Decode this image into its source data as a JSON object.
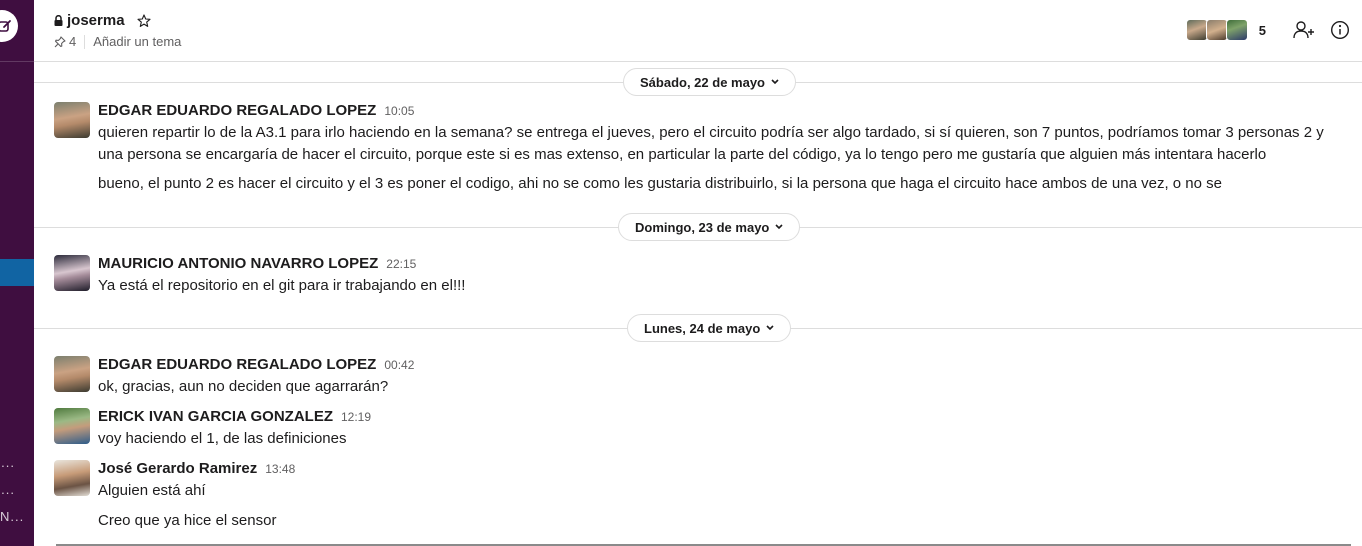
{
  "sidebar": {
    "truncated_items": [
      "...",
      "...",
      "N..."
    ],
    "compose_icon": "compose-icon"
  },
  "header": {
    "channel_name": "joserma",
    "pin_count": "4",
    "topic_placeholder": "Añadir un tema",
    "member_count": "5",
    "icons": [
      "lock-icon",
      "star-icon",
      "pin-icon",
      "add-member-icon",
      "info-icon"
    ]
  },
  "date_dividers": [
    {
      "label": "Sábado, 22 de mayo"
    },
    {
      "label": "Domingo, 23 de mayo"
    },
    {
      "label": "Lunes, 24 de mayo"
    }
  ],
  "messages": [
    {
      "sender": "EDGAR EDUARDO REGALADO LOPEZ",
      "time": "10:05",
      "lines": [
        "quieren repartir lo de la A3.1 para irlo haciendo en la semana? se entrega el jueves, pero el circuito podría ser algo tardado, si sí quieren, son 7 puntos, podríamos tomar 3 personas 2 y una persona se encargaría de hacer el circuito, porque este si es mas extenso, en particular la parte del código, ya lo tengo pero me gustaría que alguien más intentara hacerlo",
        "bueno, el punto 2 es hacer el circuito y el 3 es poner el codigo, ahi no se como les gustaria distribuirlo, si la persona que haga el circuito hace ambos de una vez, o no se"
      ]
    },
    {
      "sender": "MAURICIO ANTONIO NAVARRO LOPEZ",
      "time": "22:15",
      "lines": [
        "Ya está el repositorio en el git para ir trabajando en el!!!"
      ]
    },
    {
      "sender": "EDGAR EDUARDO REGALADO LOPEZ",
      "time": "00:42",
      "lines": [
        "ok, gracias, aun no deciden que agarrarán?"
      ]
    },
    {
      "sender": "ERICK IVAN GARCIA GONZALEZ",
      "time": "12:19",
      "lines": [
        "voy haciendo el 1, de las definiciones"
      ]
    },
    {
      "sender": "José Gerardo Ramirez",
      "time": "13:48",
      "lines": [
        "Alguien está ahí",
        "Creo que ya hice el sensor"
      ]
    }
  ],
  "colors": {
    "sidebar_bg": "#3f0e40",
    "sidebar_active": "#1164a3",
    "text": "#1d1c1d",
    "muted": "#616061",
    "border": "#dddddd"
  }
}
